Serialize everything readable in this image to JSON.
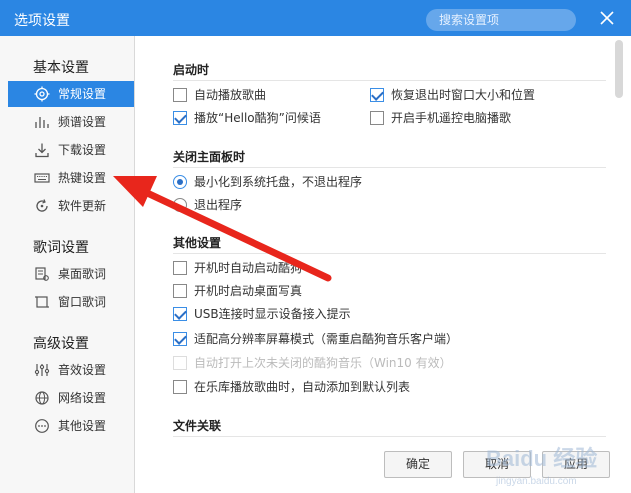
{
  "window": {
    "title": "选项设置",
    "search_placeholder": "搜索设置项"
  },
  "sidebar": {
    "groups": [
      {
        "title": "基本设置",
        "items": [
          {
            "label": "常规设置",
            "icon": "target-icon",
            "active": true
          },
          {
            "label": "频谱设置",
            "icon": "spectrum-icon"
          },
          {
            "label": "下载设置",
            "icon": "download-icon"
          },
          {
            "label": "热键设置",
            "icon": "keyboard-icon"
          },
          {
            "label": "软件更新",
            "icon": "refresh-icon"
          }
        ]
      },
      {
        "title": "歌词设置",
        "items": [
          {
            "label": "桌面歌词",
            "icon": "desktop-lyrics-icon"
          },
          {
            "label": "窗口歌词",
            "icon": "window-lyrics-icon"
          }
        ]
      },
      {
        "title": "高级设置",
        "items": [
          {
            "label": "音效设置",
            "icon": "equalizer-icon"
          },
          {
            "label": "网络设置",
            "icon": "globe-icon"
          },
          {
            "label": "其他设置",
            "icon": "more-icon"
          }
        ]
      }
    ]
  },
  "main": {
    "startup": {
      "title": "启动时",
      "options": [
        {
          "label": "自动播放歌曲",
          "checked": false
        },
        {
          "label": "恢复退出时窗口大小和位置",
          "checked": true
        },
        {
          "label": "播放“Hello酷狗”问候语",
          "checked": true
        },
        {
          "label": "开启手机遥控电脑播歌",
          "checked": false
        }
      ]
    },
    "close_panel": {
      "title": "关闭主面板时",
      "options": [
        {
          "label": "最小化到系统托盘，不退出程序",
          "selected": true
        },
        {
          "label": "退出程序",
          "selected": false
        }
      ]
    },
    "other": {
      "title": "其他设置",
      "options": [
        {
          "label": "开机时自动启动酷狗",
          "checked": false,
          "disabled": false
        },
        {
          "label": "开机时启动桌面写真",
          "checked": false,
          "disabled": false
        },
        {
          "label": "USB连接时显示设备接入提示",
          "checked": true,
          "disabled": false
        },
        {
          "label": "适配高分辨率屏幕模式（需重启酷狗音乐客户端）",
          "checked": true,
          "disabled": false
        },
        {
          "label": "自动打开上次未关闭的酷狗音乐（Win10 有效）",
          "checked": false,
          "disabled": true
        },
        {
          "label": "在乐库播放歌曲时，自动添加到默认列表",
          "checked": false,
          "disabled": false
        }
      ]
    },
    "file_assoc": {
      "title": "文件关联"
    }
  },
  "footer": {
    "ok_label": "确定",
    "cancel_label": "取消",
    "apply_label": "应用"
  },
  "colors": {
    "accent": "#2b86e3",
    "arrow": "#e8261c"
  },
  "watermark": {
    "text": "Baidu 经验",
    "subtext": "jingyan.baidu.com"
  }
}
